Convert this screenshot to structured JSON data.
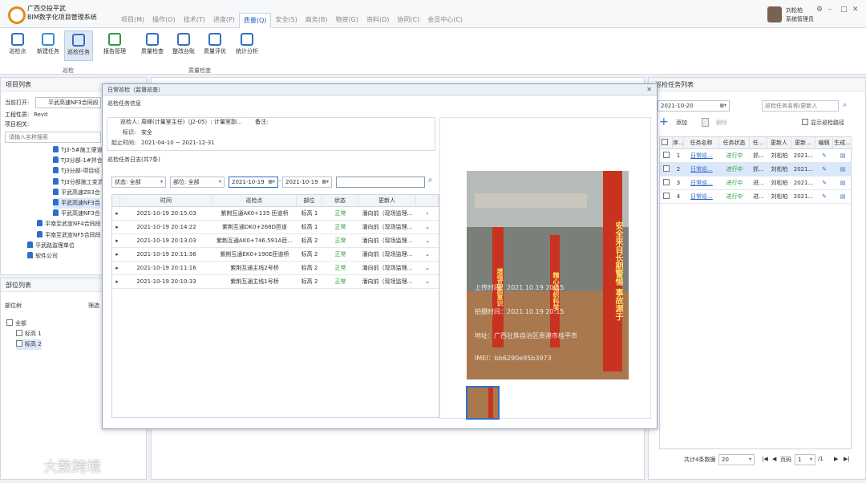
{
  "app": {
    "title_line1": "广西交投平武",
    "title_line2": "BIM数字化项目管理系统"
  },
  "tabs": [
    "项目(M)",
    "操作(O)",
    "技术(T)",
    "进度(P)",
    "质量(Q)",
    "安全(S)",
    "商务(B)",
    "物资(G)",
    "资料(D)",
    "协同(C)",
    "会员中心(C)"
  ],
  "active_tab": "质量(Q)",
  "user": {
    "name": "刘松柏",
    "role": "系统管理员"
  },
  "window_controls": [
    "⚙",
    "–",
    "□",
    "✕"
  ],
  "ribbon": {
    "buttons": [
      {
        "label": "巡检点",
        "icon": "location-pin-icon"
      },
      {
        "label": "新建任务",
        "icon": "document-icon"
      },
      {
        "label": "巡检任务",
        "icon": "task-list-icon"
      },
      {
        "label": "报告管理",
        "icon": "report-icon"
      },
      {
        "label": "质量检查",
        "icon": "quality-check-icon"
      },
      {
        "label": "整改台账",
        "icon": "ledger-icon"
      },
      {
        "label": "质量评优",
        "icon": "award-icon"
      },
      {
        "label": "统计分析",
        "icon": "pie-chart-icon"
      }
    ],
    "groups": [
      "巡检",
      "质量检查"
    ]
  },
  "project_panel": {
    "title": "项目列表",
    "current_label": "当前打开:",
    "current_value": "平武高速NF3合同段",
    "model_label": "工程性质:",
    "model_value": "Revit",
    "related_label": "项目相关:",
    "search_placeholder": "请输入名称搜索",
    "tree": [
      "TJ3-5#施工便道",
      "TJ3分部-1#拌合",
      "TJ3分部-项目经",
      "TJ3分部施工变流",
      "平武高速Z83合",
      "平武高速NF3合",
      "平武高速NF3合",
      "平南至武宣NF4合同段",
      "平南至武宣NF5合同段",
      "平武路监理单位",
      "软件公司"
    ]
  },
  "part_panel": {
    "title": "部位列表",
    "tree_label": "部位树",
    "filter_label": "筛选",
    "items": [
      "全部",
      "标高 1",
      "标高 2"
    ]
  },
  "dialog": {
    "title": "日常巡检（监督巡查）",
    "section_info": "巡检任务信息",
    "inspector_label": "巡检人:",
    "inspector_value": "周峰(计量室主任)（J2-05）: 计量室副...",
    "remark_label": "备注:",
    "target_label": "标识:",
    "target_value": "安全",
    "period_label": "起止时间:",
    "period_value": "2021-04-10 ~ 2021-12-31",
    "log_title": "巡检任务日志(共7条)",
    "filters": {
      "status": "状态: 全部",
      "part": "部位: 全部",
      "date_from": "2021-10-19",
      "date_to": "2021-10-19",
      "search": ""
    },
    "columns": [
      "时间",
      "巡检点",
      "部位",
      "状态",
      "更新人"
    ],
    "rows": [
      {
        "time": "2021-10-19 20:15:03",
        "point": "紫荆互通AK0+135 匝道桥",
        "part": "标高 1",
        "status": "正常",
        "updater": "潘向前（现场监理..."
      },
      {
        "time": "2021-10-19 20:14:22",
        "point": "紫荆互通DK0+268D匝道",
        "part": "标高 1",
        "status": "正常",
        "updater": "潘向前（现场监理..."
      },
      {
        "time": "2021-10-19 20:13:03",
        "point": "紫荆互通AK0+746.591A匝...",
        "part": "标高 2",
        "status": "正常",
        "updater": "潘向前（现场监理..."
      },
      {
        "time": "2021-10-19 20:11:36",
        "point": "紫荆互通EK0+190E匝道桥",
        "part": "标高 2",
        "status": "正常",
        "updater": "潘向前（现场监理..."
      },
      {
        "time": "2021-10-19 20:11:16",
        "point": "紫荆互通主线2号桥",
        "part": "标高 2",
        "status": "正常",
        "updater": "潘向前（现场监理..."
      },
      {
        "time": "2021-10-19 20:10:33",
        "point": "紫荆互通主线1号桥",
        "part": "标高 2",
        "status": "正常",
        "updater": "潘向前（现场监理..."
      }
    ],
    "photo": {
      "banner_right": "安全来自长期警惕 事故源于",
      "banner_left": "增强品质意识",
      "banner_mid": "精心组织科学",
      "wm_upload": "上传时间：2021.10.19 20:15",
      "wm_shoot": "拍摄时间：2021.10.19 20:15",
      "wm_addr": "地址：广西壮族自治区贵港市桂平市",
      "wm_imei": "IMEI：bb6290e95b3973"
    }
  },
  "task_panel": {
    "title": "巡检任务列表",
    "date": "2021-10-20",
    "search_placeholder": "巡检任务名称/更新人",
    "add_label": "添加",
    "delete_label": "删除",
    "show_route_label": "显示巡检路径",
    "columns": [
      "序...",
      "任务名称",
      "任务状态",
      "任...",
      "更新人",
      "更新...",
      "编辑",
      "生成..."
    ],
    "rows": [
      {
        "no": "1",
        "name": "日常巡...",
        "status": "进行中",
        "type": "抓...",
        "updater": "刘松柏",
        "date": "2021..."
      },
      {
        "no": "2",
        "name": "日常巡...",
        "status": "进行中",
        "type": "抓...",
        "updater": "刘松柏",
        "date": "2021..."
      },
      {
        "no": "3",
        "name": "日常巡...",
        "status": "进行中",
        "type": "进...",
        "updater": "刘松柏",
        "date": "2021..."
      },
      {
        "no": "4",
        "name": "日常巡...",
        "status": "进行中",
        "type": "进...",
        "updater": "刘松柏",
        "date": "2021..."
      }
    ],
    "footer": {
      "total": "共计4条数据",
      "page_size": "20",
      "page_label": "页码",
      "page": "1",
      "page_total": "/1"
    }
  },
  "watermark": "大数跨境"
}
